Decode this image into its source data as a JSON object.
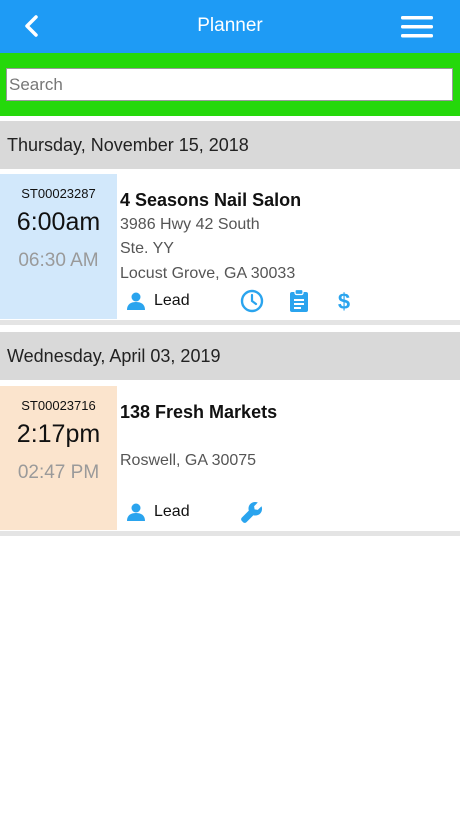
{
  "header": {
    "title": "Planner",
    "background_color": "#1e9bf5",
    "back_icon": "chevron-left-icon",
    "menu_icon": "hamburger-menu-icon"
  },
  "search": {
    "placeholder": "Search",
    "value": "",
    "band_color": "#25d80b"
  },
  "groups": [
    {
      "date": "Thursday, November 15, 2018",
      "appointments": [
        {
          "ref": "ST00023287",
          "start": "6:00am",
          "end": "06:30 AM",
          "color": "#d2e8fb",
          "name": "4 Seasons Nail Salon",
          "address_lines": [
            "3986 Hwy 42 South",
            "Ste. YY",
            "Locust Grove, GA 30033"
          ],
          "lead_label": "Lead",
          "actions": [
            "person-icon",
            "clock-icon",
            "clipboard-icon",
            "dollar-icon"
          ]
        }
      ]
    },
    {
      "date": "Wednesday, April 03, 2019",
      "appointments": [
        {
          "ref": "ST00023716",
          "start": "2:17pm",
          "end": "02:47 PM",
          "color": "#fbe4cd",
          "name": "138 Fresh Markets",
          "address_lines": [
            "",
            "Roswell, GA 30075"
          ],
          "lead_label": "Lead",
          "actions": [
            "person-icon",
            "wrench-icon"
          ]
        }
      ]
    }
  ],
  "icon_color": "#2aa4ee"
}
